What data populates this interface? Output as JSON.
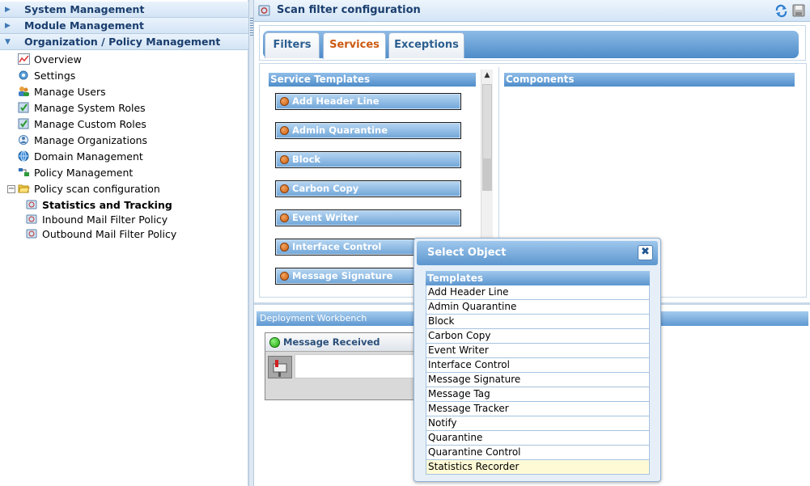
{
  "left_nav": {
    "sections": [
      {
        "label": "System Management"
      },
      {
        "label": "Module Management"
      },
      {
        "label": "Organization / Policy Management"
      }
    ],
    "items": [
      {
        "label": "Overview"
      },
      {
        "label": "Settings"
      },
      {
        "label": "Manage Users"
      },
      {
        "label": "Manage System Roles"
      },
      {
        "label": "Manage Custom Roles"
      },
      {
        "label": "Manage Organizations"
      },
      {
        "label": "Domain Management"
      },
      {
        "label": "Policy Management"
      },
      {
        "label": "Policy scan configuration"
      }
    ],
    "subitems": [
      {
        "label": "Statistics and Tracking"
      },
      {
        "label": "Inbound Mail Filter Policy"
      },
      {
        "label": "Outbound Mail Filter Policy"
      }
    ]
  },
  "main": {
    "title": "Scan filter configuration",
    "tabs": [
      {
        "label": "Filters"
      },
      {
        "label": "Services"
      },
      {
        "label": "Exceptions"
      }
    ],
    "active_tab": "Services",
    "service_templates_title": "Service  Templates",
    "components_title": "Components",
    "templates": [
      {
        "label": "Add Header Line"
      },
      {
        "label": "Admin Quarantine"
      },
      {
        "label": "Block"
      },
      {
        "label": "Carbon Copy"
      },
      {
        "label": "Event Writer"
      },
      {
        "label": "Interface Control"
      },
      {
        "label": "Message Signature"
      }
    ],
    "workbench_title": "Deployment Workbench",
    "message_received": "Message Received"
  },
  "modal": {
    "title": "Select Object",
    "close": "✖",
    "list_header": "Templates",
    "items": [
      {
        "label": "Add Header Line"
      },
      {
        "label": "Admin Quarantine"
      },
      {
        "label": "Block"
      },
      {
        "label": "Carbon Copy"
      },
      {
        "label": "Event Writer"
      },
      {
        "label": "Interface Control"
      },
      {
        "label": "Message Signature"
      },
      {
        "label": "Message Tag"
      },
      {
        "label": "Message Tracker"
      },
      {
        "label": "Notify"
      },
      {
        "label": "Quarantine"
      },
      {
        "label": "Quarantine Control"
      },
      {
        "label": "Statistics Recorder"
      }
    ],
    "selected": "Statistics Recorder"
  },
  "colors": {
    "accent_blue": "#4f8dca",
    "active_tab": "#cc5a10",
    "selected_row": "#fffad6"
  }
}
